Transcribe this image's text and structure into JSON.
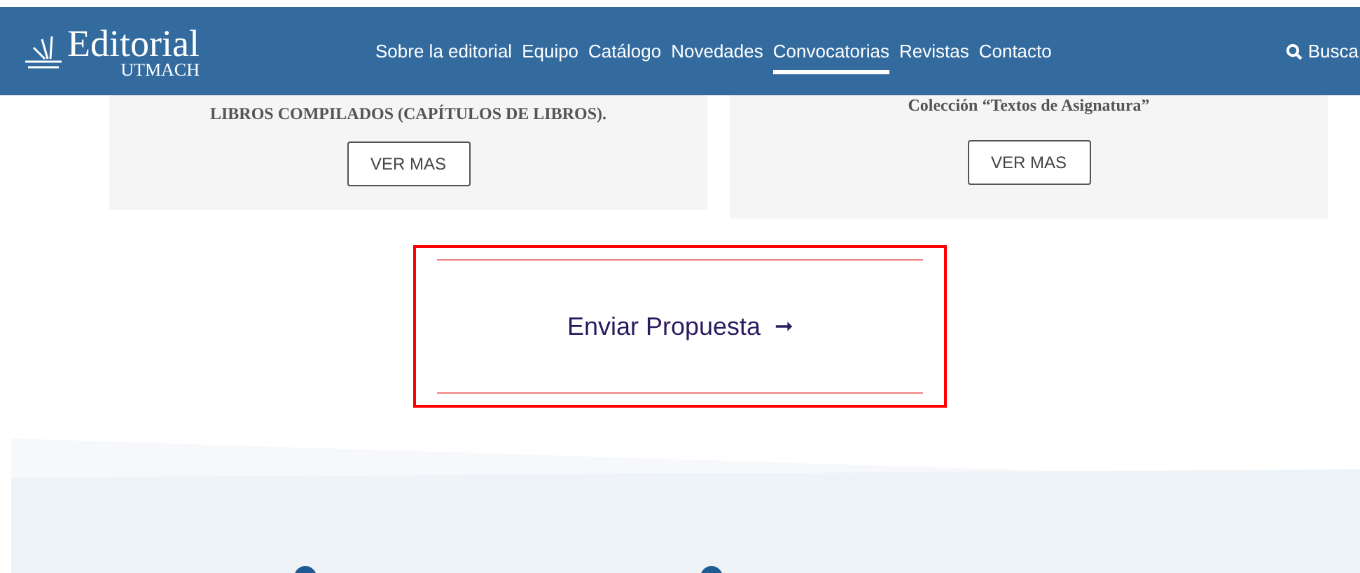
{
  "header": {
    "logo": {
      "title": "Editorial",
      "subtitle": "UTMACH"
    },
    "nav": [
      {
        "label": "Sobre la editorial",
        "selected": false
      },
      {
        "label": "Equipo",
        "selected": false
      },
      {
        "label": "Catálogo",
        "selected": false
      },
      {
        "label": "Novedades",
        "selected": false
      },
      {
        "label": "Convocatorias",
        "selected": true
      },
      {
        "label": "Revistas",
        "selected": false
      },
      {
        "label": "Contacto",
        "selected": false
      }
    ],
    "search": {
      "label": "Busca"
    }
  },
  "cards": [
    {
      "title": "LIBROS COMPILADOS (CAPÍTULOS DE LIBROS).",
      "button": "VER MAS"
    },
    {
      "title": "Colección “Textos de Asignatura”",
      "button": "VER MAS"
    }
  ],
  "cta": {
    "label": "Enviar Propuesta",
    "arrow": "➞"
  }
}
